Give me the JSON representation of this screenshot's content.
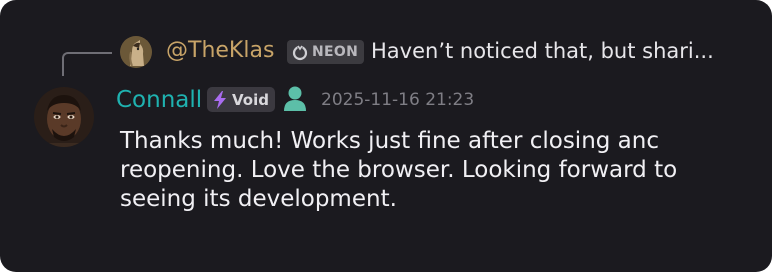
{
  "reply": {
    "author": "@TheKlas",
    "badge_label": "NEON",
    "preview_text": "Haven’t noticed that, but shari..."
  },
  "message": {
    "author": "Connall",
    "role_label": "Void",
    "timestamp": "2025-11-16 21:23",
    "body": "Thanks much! Works just fine after closing anc\nreopening. Love the browser. Looking forward to\nseeing its development."
  },
  "colors": {
    "background": "#1b1a1f",
    "reply_author": "#c8a468",
    "author": "#1fb2b0",
    "role_accent": "#a96cf0",
    "presence": "#5cbfa8",
    "timestamp": "#7f7e85"
  },
  "icons": {
    "reply_avatar": "horse-avatar-icon",
    "reply_badge": "neon-badge-icon",
    "role": "lightning-bolt-icon",
    "presence": "user-presence-icon"
  }
}
